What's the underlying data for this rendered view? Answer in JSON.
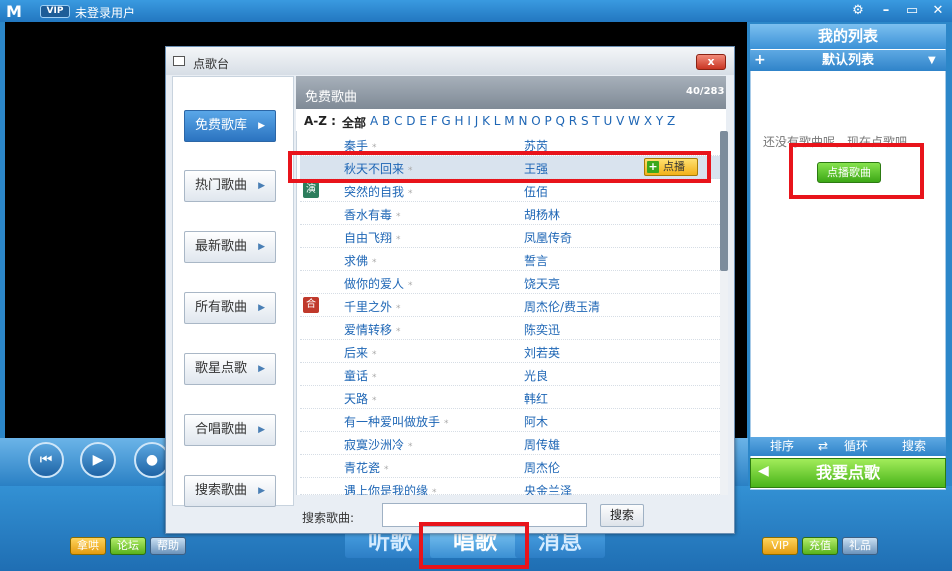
{
  "app": {
    "logo": "M",
    "vip_badge": "VIP",
    "user_status": "未登录用户",
    "window_controls": [
      "gear-icon",
      "minimize-icon",
      "maximize-icon",
      "close-icon"
    ]
  },
  "player": {
    "controls": [
      "rewind-icon",
      "play-icon",
      "stop-icon"
    ]
  },
  "bottom": {
    "left_buttons": [
      "拿哄",
      "论坛",
      "帮助"
    ],
    "tabs": [
      "听歌",
      "唱歌",
      "消息"
    ],
    "active_tab": "唱歌",
    "right_buttons": [
      "VIP",
      "充值",
      "礼品"
    ]
  },
  "right_panel": {
    "title": "我的列表",
    "list_name": "默认列表",
    "add_label": "+",
    "empty_text": "还没有歌曲呢，现在点歌吧",
    "play_button": "点播歌曲",
    "actions": [
      "排序",
      "循环",
      "搜索"
    ],
    "want_button": "我要点歌"
  },
  "dialog": {
    "title": "点歌台",
    "close_label": "x",
    "sidebar": [
      "免费歌库",
      "热门歌曲",
      "最新歌曲",
      "所有歌曲",
      "歌星点歌",
      "合唱歌曲",
      "搜索歌曲"
    ],
    "selected_sidebar": "免费歌库",
    "list_title": "免费歌曲",
    "count": "40/283",
    "az_label": "A-Z :",
    "az_all": "全部",
    "az_letters": "A B C D E F G H I J K L M N O P Q R S T U V W X Y Z",
    "songs": [
      {
        "title": "秦手",
        "artist": "苏芮",
        "badge": ""
      },
      {
        "title": "秋天不回来",
        "artist": "王强",
        "badge": "",
        "selected": true
      },
      {
        "title": "突然的自我",
        "artist": "伍佰",
        "badge": "演"
      },
      {
        "title": "香水有毒",
        "artist": "胡杨林",
        "badge": ""
      },
      {
        "title": "自由飞翔",
        "artist": "凤凰传奇",
        "badge": ""
      },
      {
        "title": "求佛",
        "artist": "誓言",
        "badge": ""
      },
      {
        "title": "做你的爱人",
        "artist": "饶天亮",
        "badge": ""
      },
      {
        "title": "千里之外",
        "artist": "周杰伦/费玉清",
        "badge": "合"
      },
      {
        "title": "爱情转移",
        "artist": "陈奕迅",
        "badge": ""
      },
      {
        "title": "后来",
        "artist": "刘若英",
        "badge": ""
      },
      {
        "title": "童话",
        "artist": "光良",
        "badge": ""
      },
      {
        "title": "天路",
        "artist": "韩红",
        "badge": ""
      },
      {
        "title": "有一种爱叫做放手",
        "artist": "阿木",
        "badge": ""
      },
      {
        "title": "寂寞沙洲冷",
        "artist": "周传雄",
        "badge": ""
      },
      {
        "title": "青花瓷",
        "artist": "周杰伦",
        "badge": ""
      },
      {
        "title": "遇上你是我的缘",
        "artist": "央金兰泽",
        "badge": ""
      }
    ],
    "add_button": "点播",
    "search_label": "搜索歌曲:",
    "search_value": "",
    "search_button": "搜索"
  },
  "colors": {
    "accent": "#2c87c9",
    "highlight": "#e8141b",
    "link": "#1e66b5"
  }
}
